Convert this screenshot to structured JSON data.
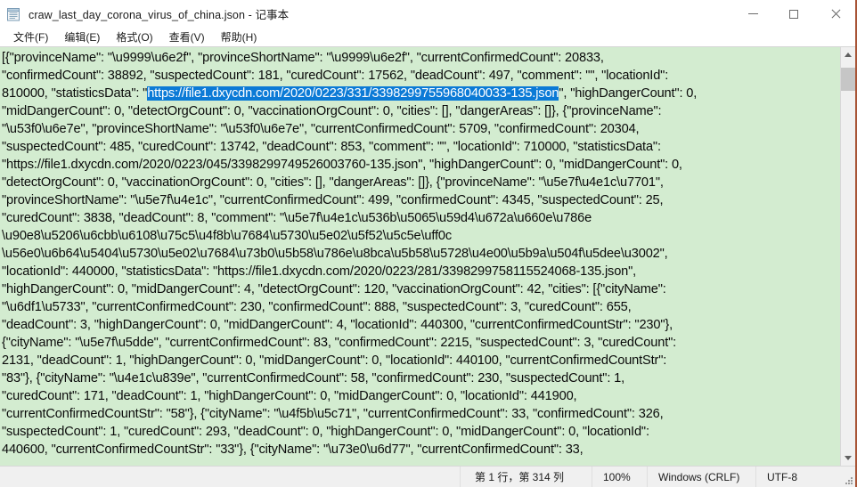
{
  "window": {
    "title": "craw_last_day_corona_virus_of_china.json - 记事本",
    "icon": "notepad-icon",
    "controls": {
      "minimize": "minimize-icon",
      "maximize": "maximize-icon",
      "close": "close-icon"
    }
  },
  "menubar": {
    "items": [
      {
        "label": "文件(F)"
      },
      {
        "label": "编辑(E)"
      },
      {
        "label": "格式(O)"
      },
      {
        "label": "查看(V)"
      },
      {
        "label": "帮助(H)"
      }
    ]
  },
  "editor": {
    "background_color": "#d3ecd0",
    "text_color": "#0a0a0a",
    "selection_color": "#0b7ad6",
    "selection_text_color": "#ffffff",
    "selected_text": "https://file1.dxycdn.com/2020/0223/331/3398299755968040033-135.json",
    "lines": [
      {
        "text": "[{\"provinceName\": \"\\u9999\\u6e2f\", \"provinceShortName\": \"\\u9999\\u6e2f\", \"currentConfirmedCount\": 20833,"
      },
      {
        "text": "\"confirmedCount\": 38892, \"suspectedCount\": 181, \"curedCount\": 17562, \"deadCount\": 497, \"comment\": \"\", \"locationId\":"
      },
      {
        "pre": "810000, \"statisticsData\": \"",
        "selected": "https://file1.dxycdn.com/2020/0223/331/3398299755968040033-135.json",
        "post": "\", \"highDangerCount\": 0,"
      },
      {
        "text": "\"midDangerCount\": 0, \"detectOrgCount\": 0, \"vaccinationOrgCount\": 0, \"cities\": [], \"dangerAreas\": []}, {\"provinceName\":"
      },
      {
        "text": "\"\\u53f0\\u6e7e\", \"provinceShortName\": \"\\u53f0\\u6e7e\", \"currentConfirmedCount\": 5709, \"confirmedCount\": 20304,"
      },
      {
        "text": "\"suspectedCount\": 485, \"curedCount\": 13742, \"deadCount\": 853, \"comment\": \"\", \"locationId\": 710000, \"statisticsData\":"
      },
      {
        "text": "\"https://file1.dxycdn.com/2020/0223/045/3398299749526003760-135.json\", \"highDangerCount\": 0, \"midDangerCount\": 0,"
      },
      {
        "text": "\"detectOrgCount\": 0, \"vaccinationOrgCount\": 0, \"cities\": [], \"dangerAreas\": []}, {\"provinceName\": \"\\u5e7f\\u4e1c\\u7701\","
      },
      {
        "text": "\"provinceShortName\": \"\\u5e7f\\u4e1c\", \"currentConfirmedCount\": 499, \"confirmedCount\": 4345, \"suspectedCount\": 25,"
      },
      {
        "text": "\"curedCount\": 3838, \"deadCount\": 8, \"comment\": \"\\u5e7f\\u4e1c\\u536b\\u5065\\u59d4\\u672a\\u660e\\u786e"
      },
      {
        "text": "\\u90e8\\u5206\\u6cbb\\u6108\\u75c5\\u4f8b\\u7684\\u5730\\u5e02\\u5f52\\u5c5e\\uff0c"
      },
      {
        "text": "\\u56e0\\u6b64\\u5404\\u5730\\u5e02\\u7684\\u73b0\\u5b58\\u786e\\u8bca\\u5b58\\u5728\\u4e00\\u5b9a\\u504f\\u5dee\\u3002\","
      },
      {
        "text": "\"locationId\": 440000, \"statisticsData\": \"https://file1.dxycdn.com/2020/0223/281/3398299758115524068-135.json\","
      },
      {
        "text": "\"highDangerCount\": 0, \"midDangerCount\": 4, \"detectOrgCount\": 120, \"vaccinationOrgCount\": 42, \"cities\": [{\"cityName\":"
      },
      {
        "text": "\"\\u6df1\\u5733\", \"currentConfirmedCount\": 230, \"confirmedCount\": 888, \"suspectedCount\": 3, \"curedCount\": 655,"
      },
      {
        "text": "\"deadCount\": 3, \"highDangerCount\": 0, \"midDangerCount\": 4, \"locationId\": 440300, \"currentConfirmedCountStr\": \"230\"},"
      },
      {
        "text": "{\"cityName\": \"\\u5e7f\\u5dde\", \"currentConfirmedCount\": 83, \"confirmedCount\": 2215, \"suspectedCount\": 3, \"curedCount\":"
      },
      {
        "text": "2131, \"deadCount\": 1, \"highDangerCount\": 0, \"midDangerCount\": 0, \"locationId\": 440100, \"currentConfirmedCountStr\":"
      },
      {
        "text": "\"83\"}, {\"cityName\": \"\\u4e1c\\u839e\", \"currentConfirmedCount\": 58, \"confirmedCount\": 230, \"suspectedCount\": 1,"
      },
      {
        "text": "\"curedCount\": 171, \"deadCount\": 1, \"highDangerCount\": 0, \"midDangerCount\": 0, \"locationId\": 441900,"
      },
      {
        "text": "\"currentConfirmedCountStr\": \"58\"}, {\"cityName\": \"\\u4f5b\\u5c71\", \"currentConfirmedCount\": 33, \"confirmedCount\": 326,"
      },
      {
        "text": "\"suspectedCount\": 1, \"curedCount\": 293, \"deadCount\": 0, \"highDangerCount\": 0, \"midDangerCount\": 0, \"locationId\":"
      },
      {
        "text": "440600, \"currentConfirmedCountStr\": \"33\"}, {\"cityName\": \"\\u73e0\\u6d77\", \"currentConfirmedCount\": 33,"
      }
    ]
  },
  "scrollbar": {
    "up_arrow": "scroll-up-icon",
    "down_arrow": "scroll-down-icon",
    "thumb": "scroll-thumb"
  },
  "statusbar": {
    "position": "第 1 行，第 314 列",
    "zoom": "100%",
    "line_ending": "Windows (CRLF)",
    "encoding": "UTF-8"
  }
}
